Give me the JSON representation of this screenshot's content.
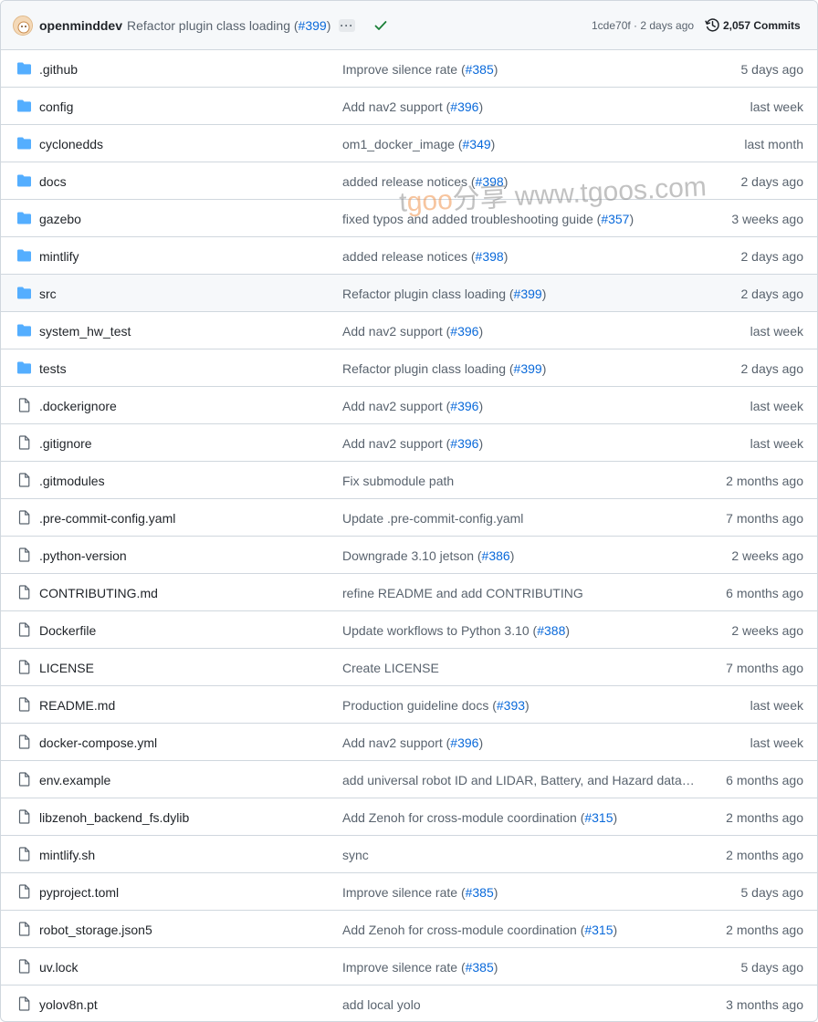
{
  "header": {
    "author": "openminddev",
    "message": "Refactor plugin class loading (",
    "pr": "#399",
    "message_close": ")",
    "sha_time": "1cde70f · 2 days ago",
    "commits_label": "2,057 Commits"
  },
  "rows": [
    {
      "type": "folder",
      "name": ".github",
      "msg": "Improve silence rate (",
      "pr": "#385",
      "close": ")",
      "date": "5 days ago"
    },
    {
      "type": "folder",
      "name": "config",
      "msg": "Add nav2 support (",
      "pr": "#396",
      "close": ")",
      "date": "last week"
    },
    {
      "type": "folder",
      "name": "cyclonedds",
      "msg": "om1_docker_image (",
      "pr": "#349",
      "close": ")",
      "date": "last month"
    },
    {
      "type": "folder",
      "name": "docs",
      "msg": "added release notices (",
      "pr": "#398",
      "close": ")",
      "date": "2 days ago"
    },
    {
      "type": "folder",
      "name": "gazebo",
      "msg": "fixed typos and added troubleshooting guide (",
      "pr": "#357",
      "close": ")",
      "date": "3 weeks ago"
    },
    {
      "type": "folder",
      "name": "mintlify",
      "msg": "added release notices (",
      "pr": "#398",
      "close": ")",
      "date": "2 days ago"
    },
    {
      "type": "folder",
      "name": "src",
      "msg": "Refactor plugin class loading (",
      "pr": "#399",
      "close": ")",
      "date": "2 days ago"
    },
    {
      "type": "folder",
      "name": "system_hw_test",
      "msg": "Add nav2 support (",
      "pr": "#396",
      "close": ")",
      "date": "last week"
    },
    {
      "type": "folder",
      "name": "tests",
      "msg": "Refactor plugin class loading (",
      "pr": "#399",
      "close": ")",
      "date": "2 days ago"
    },
    {
      "type": "file",
      "name": ".dockerignore",
      "msg": "Add nav2 support (",
      "pr": "#396",
      "close": ")",
      "date": "last week"
    },
    {
      "type": "file",
      "name": ".gitignore",
      "msg": "Add nav2 support (",
      "pr": "#396",
      "close": ")",
      "date": "last week"
    },
    {
      "type": "file",
      "name": ".gitmodules",
      "msg": "Fix submodule path",
      "pr": "",
      "close": "",
      "date": "2 months ago"
    },
    {
      "type": "file",
      "name": ".pre-commit-config.yaml",
      "msg": "Update .pre-commit-config.yaml",
      "pr": "",
      "close": "",
      "date": "7 months ago"
    },
    {
      "type": "file",
      "name": ".python-version",
      "msg": "Downgrade 3.10 jetson (",
      "pr": "#386",
      "close": ")",
      "date": "2 weeks ago"
    },
    {
      "type": "file",
      "name": "CONTRIBUTING.md",
      "msg": "refine README and add CONTRIBUTING",
      "pr": "",
      "close": "",
      "date": "6 months ago"
    },
    {
      "type": "file",
      "name": "Dockerfile",
      "msg": "Update workflows to Python 3.10 (",
      "pr": "#388",
      "close": ")",
      "date": "2 weeks ago"
    },
    {
      "type": "file",
      "name": "LICENSE",
      "msg": "Create LICENSE",
      "pr": "",
      "close": "",
      "date": "7 months ago"
    },
    {
      "type": "file",
      "name": "README.md",
      "msg": "Production guideline docs (",
      "pr": "#393",
      "close": ")",
      "date": "last week"
    },
    {
      "type": "file",
      "name": "docker-compose.yml",
      "msg": "Add nav2 support (",
      "pr": "#396",
      "close": ")",
      "date": "last week"
    },
    {
      "type": "file",
      "name": "env.example",
      "msg": "add universal robot ID and LIDAR, Battery, and Hazard data f...",
      "pr": "",
      "close": "",
      "date": "6 months ago"
    },
    {
      "type": "file",
      "name": "libzenoh_backend_fs.dylib",
      "msg": "Add Zenoh for cross-module coordination (",
      "pr": "#315",
      "close": ")",
      "date": "2 months ago"
    },
    {
      "type": "file",
      "name": "mintlify.sh",
      "msg": "sync",
      "pr": "",
      "close": "",
      "date": "2 months ago"
    },
    {
      "type": "file",
      "name": "pyproject.toml",
      "msg": "Improve silence rate (",
      "pr": "#385",
      "close": ")",
      "date": "5 days ago"
    },
    {
      "type": "file",
      "name": "robot_storage.json5",
      "msg": "Add Zenoh for cross-module coordination (",
      "pr": "#315",
      "close": ")",
      "date": "2 months ago"
    },
    {
      "type": "file",
      "name": "uv.lock",
      "msg": "Improve silence rate (",
      "pr": "#385",
      "close": ")",
      "date": "5 days ago"
    },
    {
      "type": "file",
      "name": "yolov8n.pt",
      "msg": "add local yolo",
      "pr": "",
      "close": "",
      "date": "3 months ago"
    }
  ],
  "watermark": {
    "text_a": "t",
    "text_o": "goo",
    "text_b": "分享 www.tgoos.com"
  },
  "colors": {
    "folder": "#54aeff",
    "file": "#59636e",
    "link": "#0969da",
    "check": "#1a7f37",
    "hover_row": "#f6f8fa"
  },
  "icons": {
    "folder": "folder-icon",
    "file": "file-icon",
    "history": "history-icon",
    "check": "check-icon"
  }
}
